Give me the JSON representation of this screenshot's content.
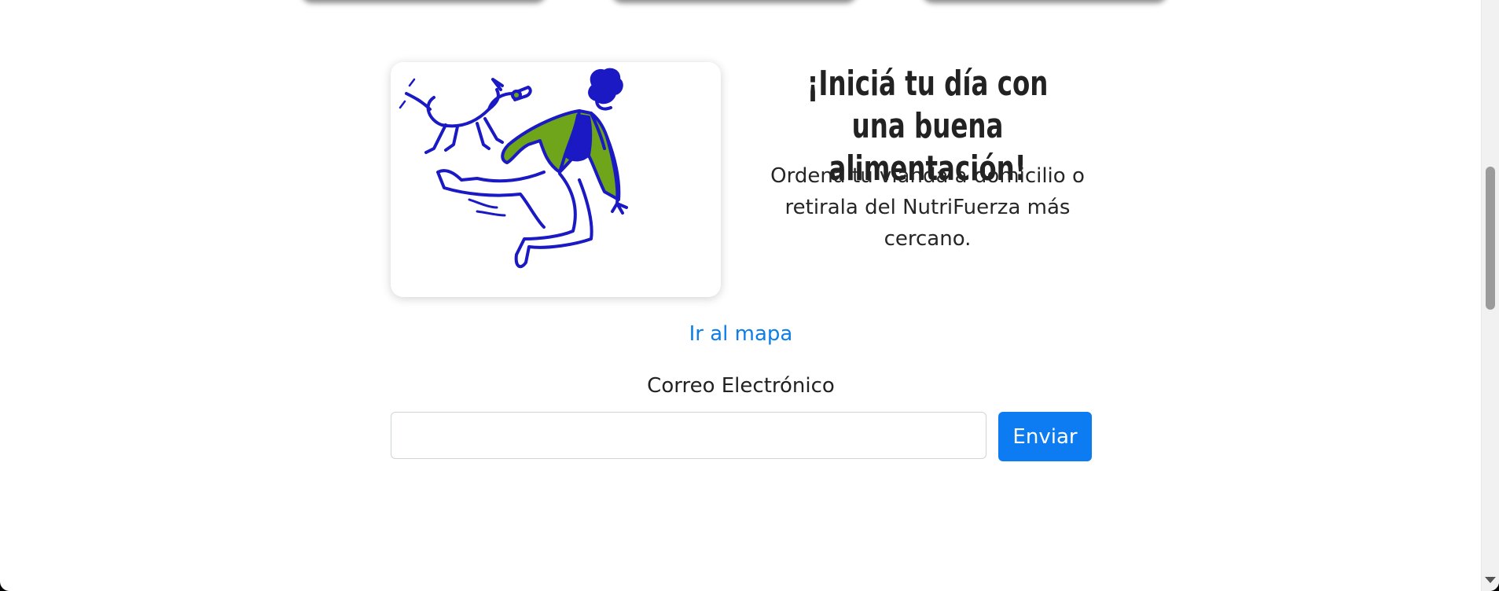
{
  "hero": {
    "title": "¡Iniciá tu día con una buena alimentación!",
    "subtitle": "Ordená tu vianda a domicilio o retirala del NutriFuerza más cercano."
  },
  "map_link": {
    "label": "Ir al mapa"
  },
  "newsletter": {
    "label": "Correo Electrónico",
    "email_value": "",
    "submit_label": "Enviar"
  },
  "illustration": {
    "subject": "person-jumping-with-dog-illustration",
    "colors": {
      "line": "#1a19c4",
      "jacket": "#6ea51a",
      "background": "#ffffff"
    }
  },
  "colors": {
    "link": "#0d7ee9",
    "button": "#0d7cf2",
    "text": "#222222"
  }
}
